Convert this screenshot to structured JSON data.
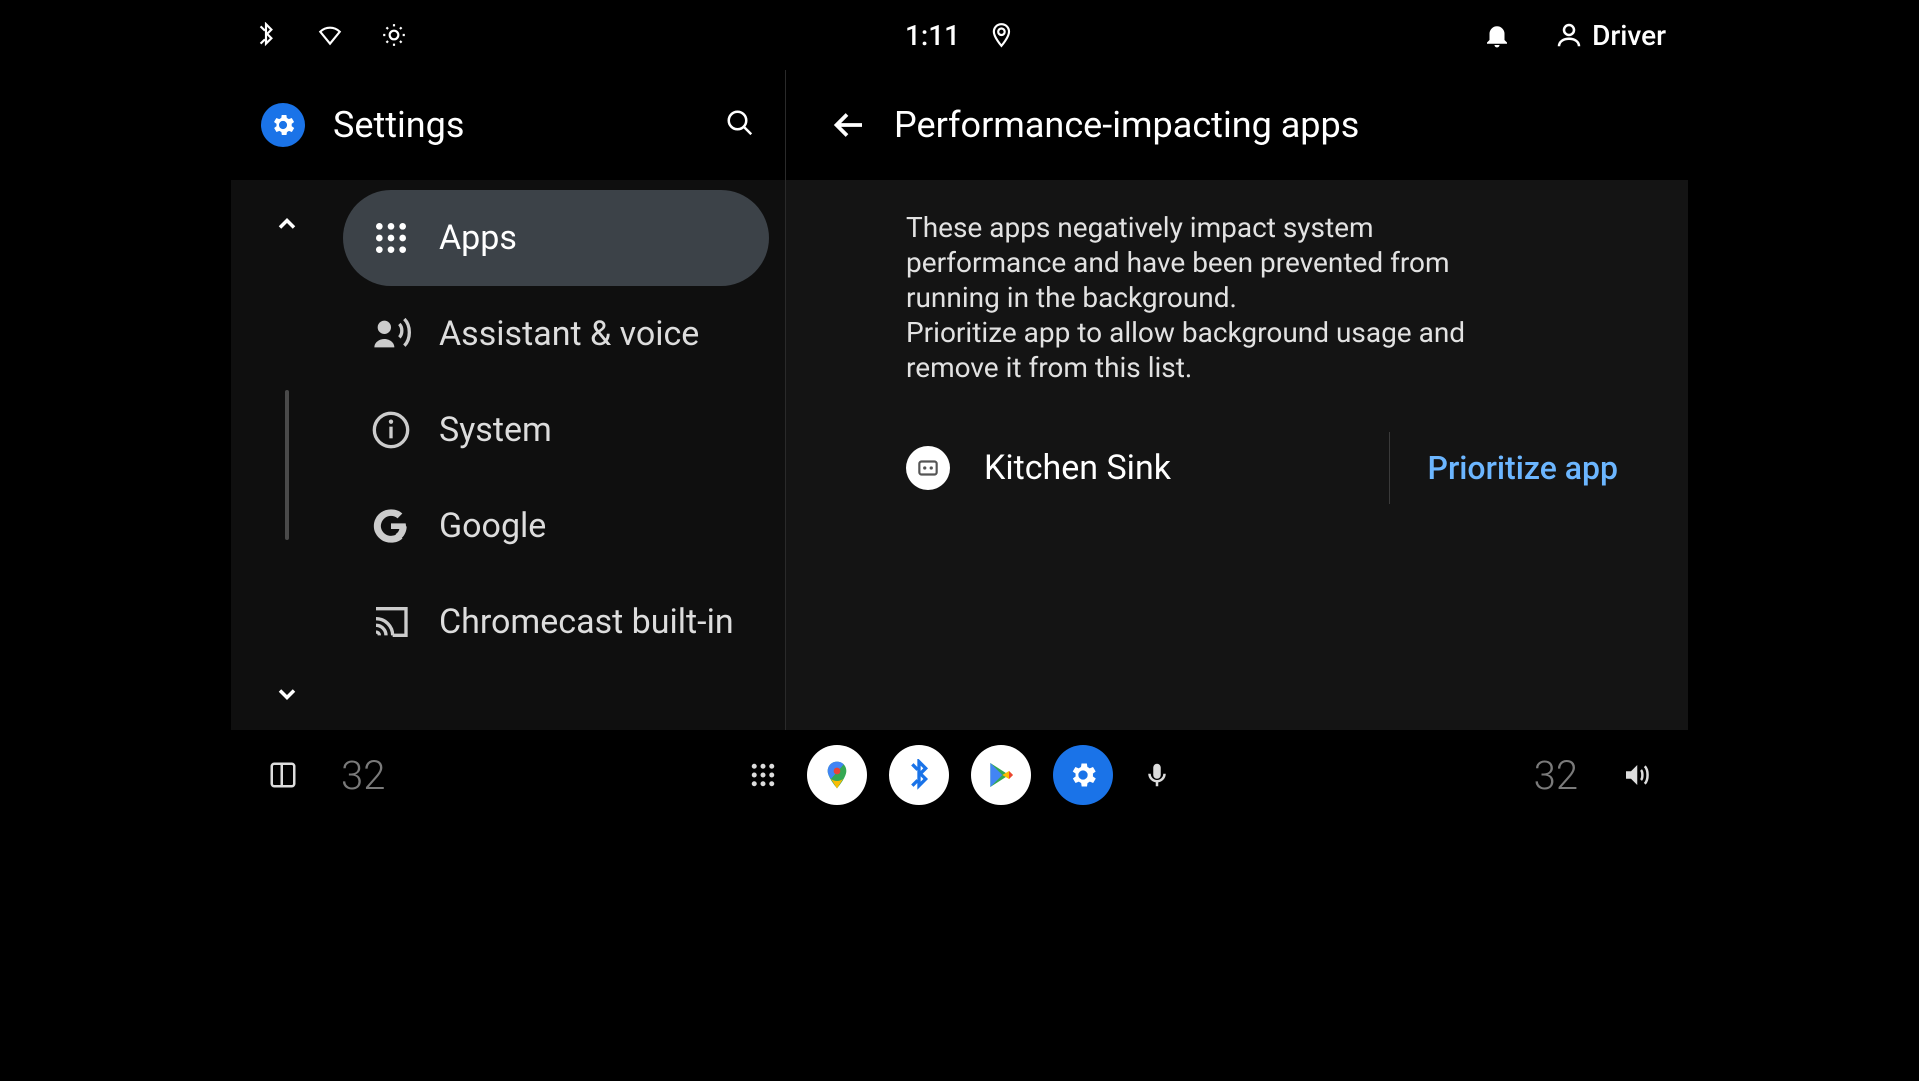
{
  "statusbar": {
    "time": "1:11",
    "profile_name": "Driver"
  },
  "sidebar": {
    "title": "Settings",
    "items": [
      {
        "label": "Apps",
        "selected": true
      },
      {
        "label": "Assistant & voice",
        "selected": false
      },
      {
        "label": "System",
        "selected": false
      },
      {
        "label": "Google",
        "selected": false
      },
      {
        "label": "Chromecast built-in",
        "selected": false
      }
    ]
  },
  "detail": {
    "title": "Performance-impacting apps",
    "description": "These apps negatively impact system performance and have been prevented from running in the background.\nPrioritize app to allow background usage and remove it from this list.",
    "apps": [
      {
        "name": "Kitchen Sink",
        "action": "Prioritize app"
      }
    ]
  },
  "dock": {
    "left_temp": "32",
    "right_temp": "32"
  },
  "colors": {
    "accent": "#1a73e8",
    "link": "#6cb6ff"
  }
}
